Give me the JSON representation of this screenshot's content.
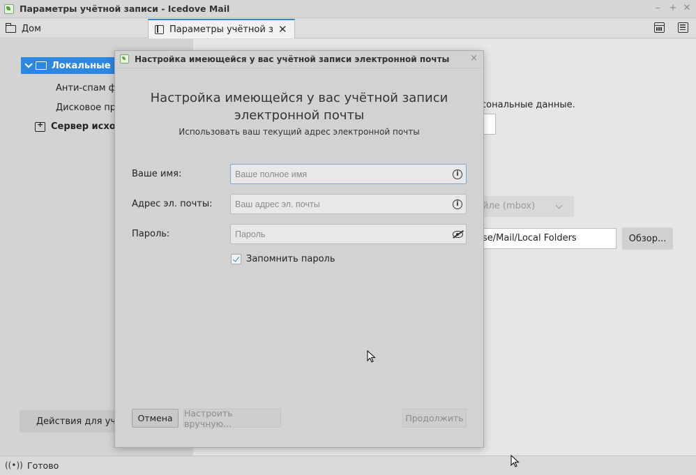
{
  "window": {
    "title": "Параметры учётной записи - Icedove Mail",
    "minimize": "–",
    "maximize": "+",
    "close": "✕"
  },
  "tabs": {
    "home": "Дом",
    "active": "Параметры учётной запис",
    "active_close": "✕"
  },
  "sidebar": {
    "selected_account": "Локальные па",
    "items": [
      "Анти-спам фи",
      "Дисковое про"
    ],
    "server": "Сервер исходя",
    "actions": "Действия для учё"
  },
  "main": {
    "personal_data_text": "сональные данные.",
    "storage_select": "йле (mbox)",
    "path_value": "se/Mail/Local Folders",
    "browse_button": "Обзор..."
  },
  "status": {
    "text": "Готово"
  },
  "dialog": {
    "title": "Настройка имеющейся у вас учётной записи электронной почты",
    "close": "×",
    "heading_line1": "Настройка имеющейся у вас учётной записи",
    "heading_line2": "электронной почты",
    "subheading": "Использовать ваш текущий адрес электронной почты",
    "name_label": "Ваше имя:",
    "name_placeholder": "Ваше полное имя",
    "email_label": "Адрес эл. почты:",
    "email_placeholder": "Ваш адрес эл. почты",
    "password_label": "Пароль:",
    "password_placeholder": "Пароль",
    "info_glyph": "i",
    "remember_label": "Запомнить пароль",
    "cancel_button": "Отмена",
    "manual_button": "Настроить вручную...",
    "continue_button": "Продолжить"
  }
}
